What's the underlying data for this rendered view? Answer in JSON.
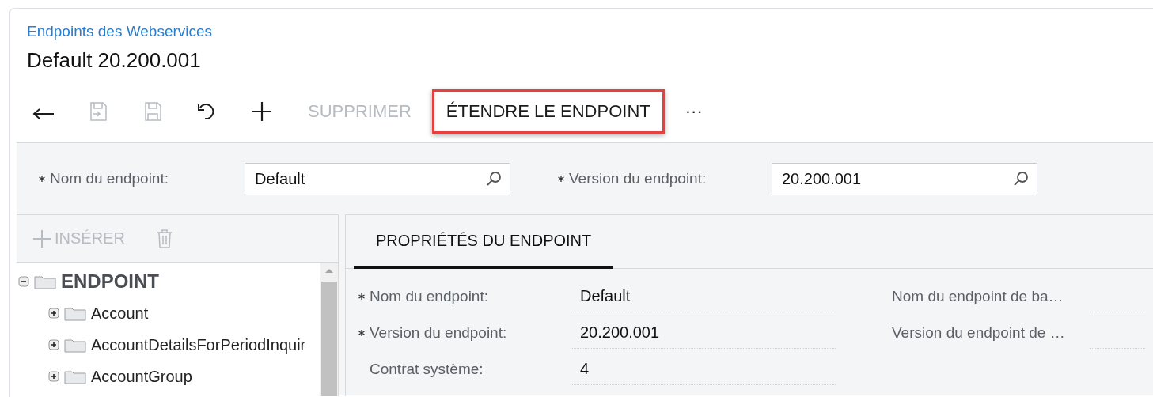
{
  "breadcrumb": "Endpoints des Webservices",
  "title": "Default 20.200.001",
  "toolbar": [
    {
      "kind": "back",
      "disabled": false,
      "highlighted": false
    },
    {
      "kind": "save-close",
      "disabled": true,
      "highlighted": false
    },
    {
      "kind": "save",
      "disabled": true,
      "highlighted": false
    },
    {
      "kind": "undo",
      "disabled": false,
      "highlighted": false
    },
    {
      "kind": "add",
      "disabled": false,
      "highlighted": false
    },
    {
      "kind": "text",
      "label": "SUPPRIMER",
      "disabled": true,
      "highlighted": false
    },
    {
      "kind": "text",
      "label": "ÉTENDRE LE ENDPOINT",
      "disabled": false,
      "highlighted": true
    },
    {
      "kind": "more",
      "label": "···",
      "disabled": false,
      "highlighted": false
    }
  ],
  "filters": [
    {
      "label": "Nom du endpoint:",
      "required": true,
      "value": "Default"
    },
    {
      "label": "Version du endpoint:",
      "required": true,
      "value": "20.200.001"
    }
  ],
  "tree_toolbar": [
    {
      "kind": "insert",
      "label": "INSÉRER",
      "disabled": true
    },
    {
      "kind": "delete",
      "disabled": true
    }
  ],
  "tree": [
    {
      "label": "ENDPOINT",
      "expanded": true,
      "children": [
        {
          "label": "Account",
          "expanded": false
        },
        {
          "label": "AccountDetailsForPeriodInquir",
          "expanded": false
        },
        {
          "label": "AccountGroup",
          "expanded": false
        }
      ]
    }
  ],
  "tabs": [
    {
      "label": "PROPRIÉTÉS DU ENDPOINT",
      "selected": true
    }
  ],
  "properties_left": [
    {
      "label": "Nom du endpoint:",
      "required": true,
      "value": "Default"
    },
    {
      "label": "Version du endpoint:",
      "required": true,
      "value": "20.200.001"
    },
    {
      "label": "Contrat système:",
      "required": false,
      "value": "4"
    }
  ],
  "properties_right": [
    {
      "label": "Nom du endpoint de ba…"
    },
    {
      "label": "Version du endpoint de …"
    }
  ]
}
